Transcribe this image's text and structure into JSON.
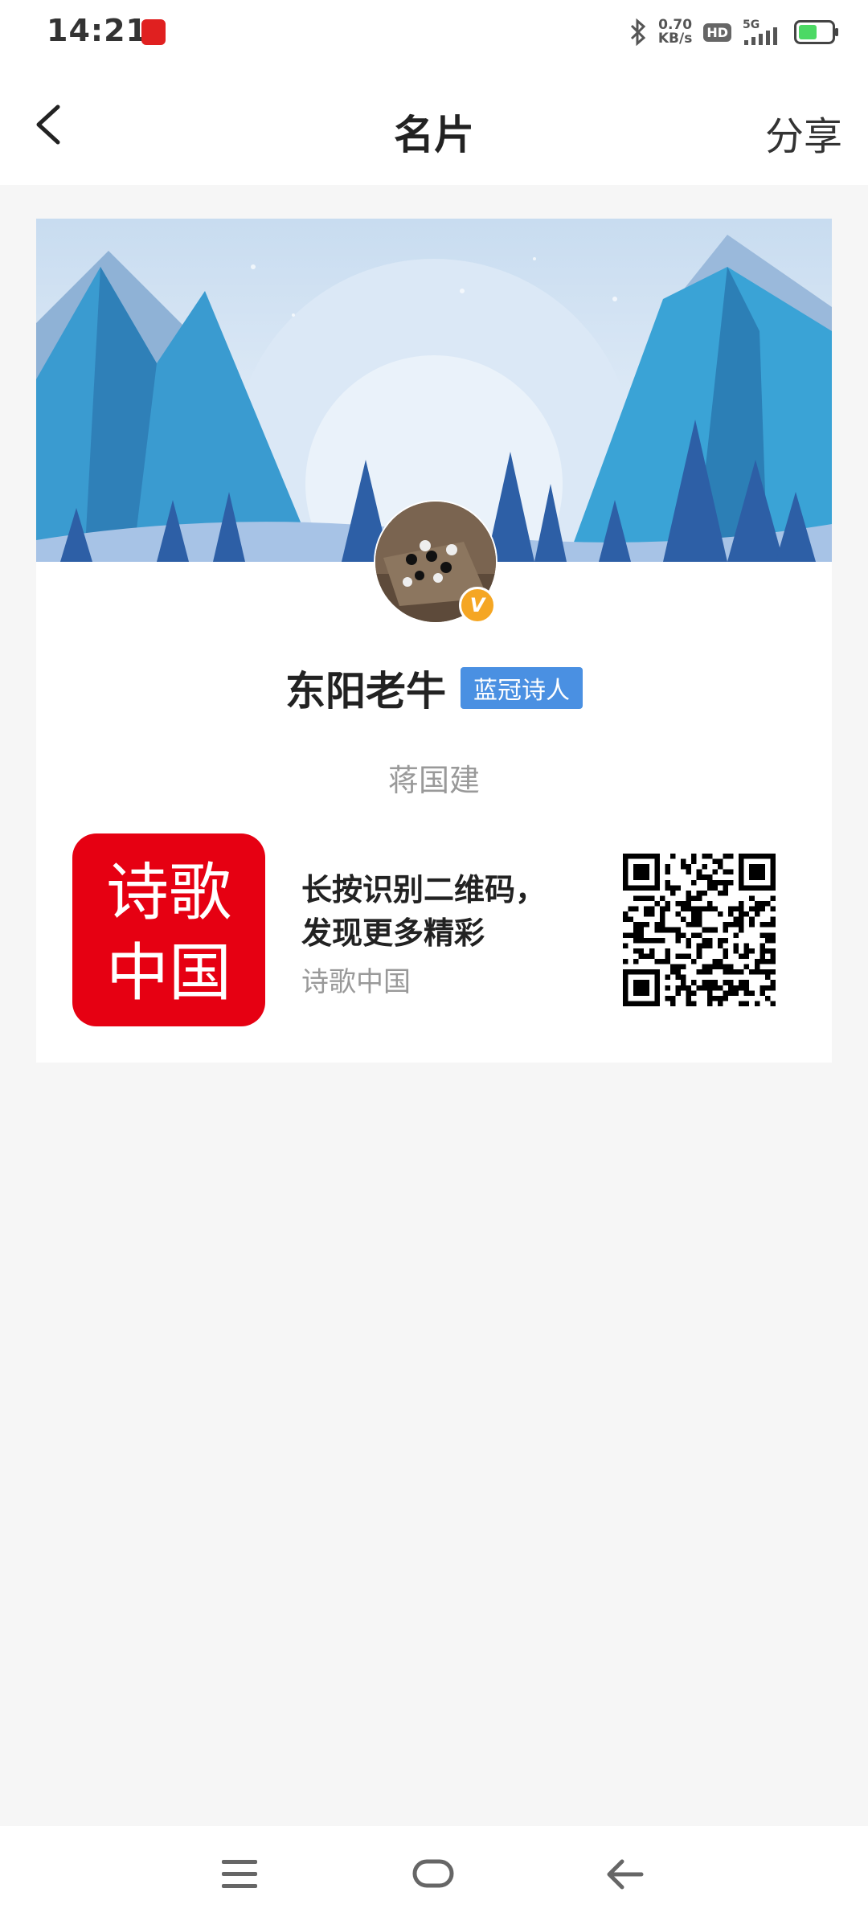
{
  "status_bar": {
    "time": "14:21",
    "net_speed_value": "0.70",
    "net_speed_unit": "KB/s",
    "hd_label": "HD",
    "network_label": "5G"
  },
  "nav": {
    "title": "名片",
    "share_label": "分享"
  },
  "profile": {
    "username": "东阳老牛",
    "badge": "蓝冠诗人",
    "real_name": "蒋国建",
    "verified_mark": "V"
  },
  "promo": {
    "line1": "长按识别二维码，",
    "line2": "发现更多精彩",
    "source": "诗歌中国",
    "logo_text_top": "诗歌",
    "logo_text_bottom": "中国"
  },
  "colors": {
    "accent_blue": "#4a90e2",
    "logo_red": "#e60012",
    "verified_orange": "#f5a623"
  }
}
